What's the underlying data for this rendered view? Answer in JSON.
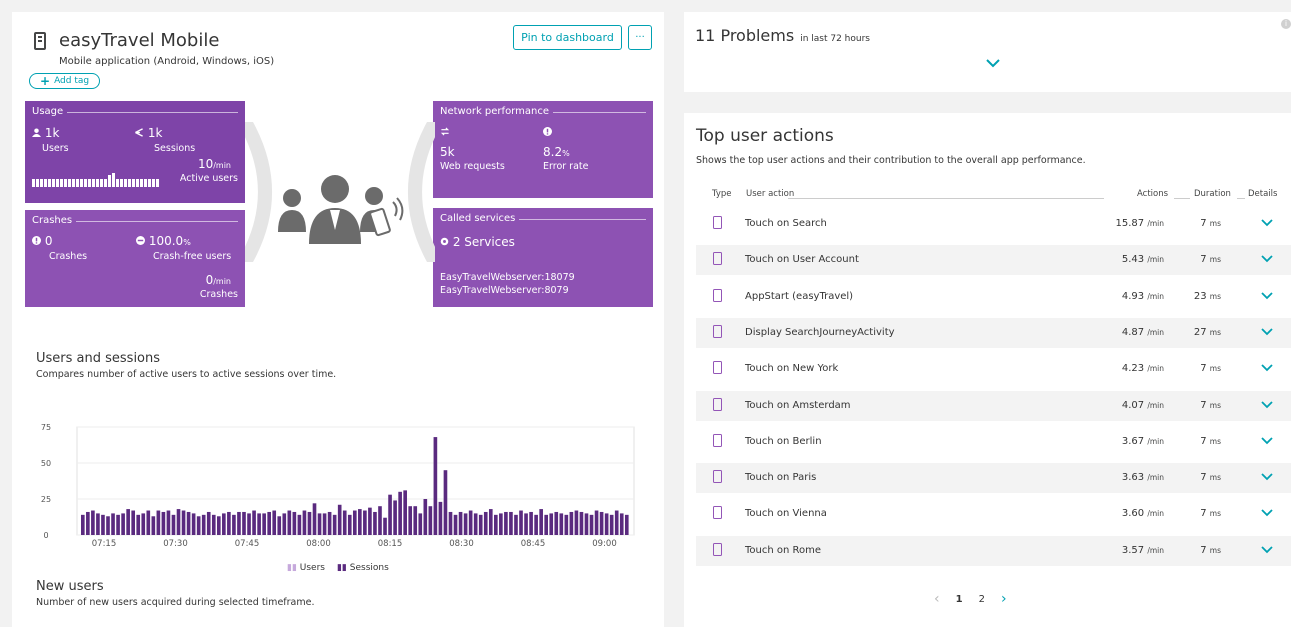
{
  "app": {
    "title": "easyTravel Mobile",
    "subtitle": "Mobile application (Android, Windows, iOS)",
    "add_tag": "Add tag",
    "pin_button": "Pin to dashboard",
    "more_button": "···"
  },
  "usage": {
    "title": "Usage",
    "users_value": "1k",
    "users_label": "Users",
    "sessions_value": "1k",
    "sessions_label": "Sessions",
    "active_value": "10",
    "active_unit": "/min",
    "active_label": "Active users",
    "icons": {
      "users": "user-icon",
      "sessions": "sessions-icon"
    }
  },
  "crashes": {
    "title": "Crashes",
    "crashes_value": "0",
    "crashes_label": "Crashes",
    "crashfree_value": "100.0",
    "crashfree_unit": "%",
    "crashfree_label": "Crash-free users",
    "rate_value": "0",
    "rate_unit": "/min",
    "rate_label": "Crashes"
  },
  "network": {
    "title": "Network performance",
    "requests_value": "5k",
    "requests_label": "Web requests",
    "error_value": "8.2",
    "error_unit": "%",
    "error_label": "Error rate"
  },
  "services": {
    "title": "Called services",
    "count": "2 Services",
    "list": [
      "EasyTravelWebserver:18079",
      "EasyTravelWebserver:8079"
    ]
  },
  "users_sessions": {
    "title": "Users and sessions",
    "subtitle": "Compares number of active users to active sessions over time."
  },
  "new_users": {
    "title": "New users",
    "subtitle": "Number of new users acquired during selected timeframe."
  },
  "chart_data": {
    "type": "bar",
    "title": "Users and sessions",
    "ylim": [
      0,
      75
    ],
    "yticks": [
      0,
      25,
      50,
      75
    ],
    "xticks": [
      "07:15",
      "07:30",
      "07:45",
      "08:00",
      "08:15",
      "08:30",
      "08:45",
      "09:00"
    ],
    "grid": true,
    "legend_position": "bottom-center",
    "series": [
      {
        "name": "Users",
        "color": "#c6a9dc"
      },
      {
        "name": "Sessions",
        "color": "#5a2a7f",
        "values": [
          14,
          16,
          17,
          15,
          14,
          13,
          15,
          14,
          15,
          18,
          17,
          14,
          15,
          17,
          13,
          17,
          16,
          17,
          14,
          18,
          17,
          16,
          15,
          13,
          14,
          16,
          14,
          13,
          15,
          16,
          14,
          16,
          16,
          15,
          17,
          15,
          15,
          16,
          17,
          13,
          15,
          17,
          16,
          14,
          17,
          16,
          22,
          15,
          15,
          16,
          14,
          21,
          17,
          14,
          17,
          18,
          17,
          19,
          16,
          20,
          12,
          28,
          24,
          30,
          31,
          20,
          20,
          15,
          25,
          20,
          68,
          23,
          45,
          16,
          14,
          16,
          15,
          17,
          15,
          14,
          16,
          18,
          14,
          15,
          16,
          16,
          14,
          17,
          15,
          16,
          14,
          18,
          14,
          15,
          16,
          15,
          14,
          16,
          17,
          16,
          15,
          14,
          17,
          16,
          15,
          14,
          17,
          15,
          14
        ]
      }
    ]
  },
  "problems": {
    "count_text": "11 Problems",
    "timeframe": "in last 72 hours"
  },
  "top_actions": {
    "title": "Top user actions",
    "subtitle": "Shows the top user actions and their contribution to the overall app performance.",
    "headers": {
      "type": "Type",
      "action": "User action",
      "actions": "Actions",
      "duration": "Duration",
      "details": "Details"
    },
    "rows": [
      {
        "label": "Touch on Search",
        "actions": "15.87",
        "unit": "/min",
        "duration": "7",
        "dunit": "ms"
      },
      {
        "label": "Touch on User Account",
        "actions": "5.43",
        "unit": "/min",
        "duration": "7",
        "dunit": "ms"
      },
      {
        "label": "AppStart (easyTravel)",
        "actions": "4.93",
        "unit": "/min",
        "duration": "23",
        "dunit": "ms"
      },
      {
        "label": "Display SearchJourneyActivity",
        "actions": "4.87",
        "unit": "/min",
        "duration": "27",
        "dunit": "ms"
      },
      {
        "label": "Touch on New York",
        "actions": "4.23",
        "unit": "/min",
        "duration": "7",
        "dunit": "ms"
      },
      {
        "label": "Touch on Amsterdam",
        "actions": "4.07",
        "unit": "/min",
        "duration": "7",
        "dunit": "ms"
      },
      {
        "label": "Touch on Berlin",
        "actions": "3.67",
        "unit": "/min",
        "duration": "7",
        "dunit": "ms"
      },
      {
        "label": "Touch on Paris",
        "actions": "3.63",
        "unit": "/min",
        "duration": "7",
        "dunit": "ms"
      },
      {
        "label": "Touch on Vienna",
        "actions": "3.60",
        "unit": "/min",
        "duration": "7",
        "dunit": "ms"
      },
      {
        "label": "Touch on Rome",
        "actions": "3.57",
        "unit": "/min",
        "duration": "7",
        "dunit": "ms"
      }
    ],
    "pages": [
      "1",
      "2"
    ],
    "pager_prev": "‹",
    "pager_next": "›"
  }
}
